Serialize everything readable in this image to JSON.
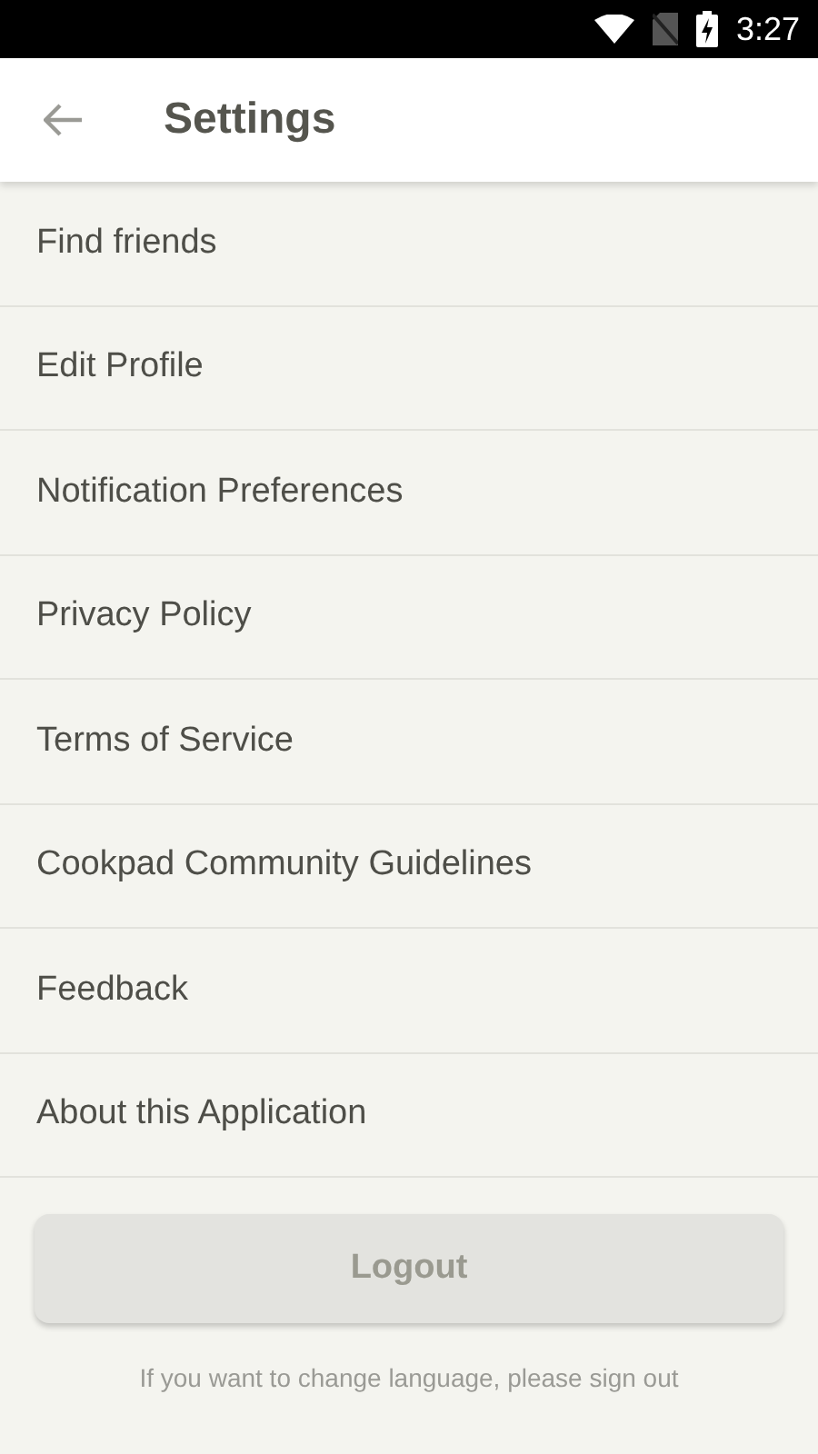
{
  "status_bar": {
    "time": "3:27"
  },
  "app_bar": {
    "title": "Settings"
  },
  "items": [
    {
      "label": "Find friends"
    },
    {
      "label": "Edit Profile"
    },
    {
      "label": "Notification Preferences"
    },
    {
      "label": "Privacy Policy"
    },
    {
      "label": "Terms of Service"
    },
    {
      "label": "Cookpad Community Guidelines"
    },
    {
      "label": "Feedback"
    },
    {
      "label": "About this Application"
    }
  ],
  "logout_button": {
    "label": "Logout"
  },
  "note": "If you want to change language, please sign out"
}
